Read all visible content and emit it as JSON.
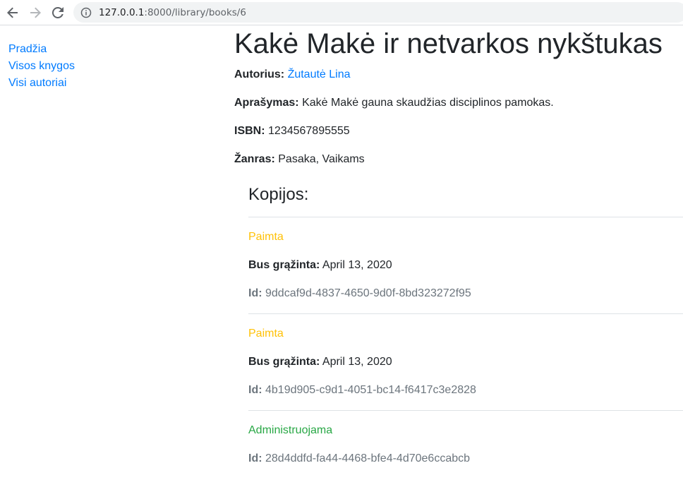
{
  "browser": {
    "url_host": "127.0.0.1",
    "url_path": ":8000/library/books/6"
  },
  "sidebar": {
    "items": [
      {
        "label": "Pradžia"
      },
      {
        "label": "Visos knygos"
      },
      {
        "label": "Visi autoriai"
      }
    ]
  },
  "book": {
    "title": "Kakė Makė ir netvarkos nykštukas",
    "author_label": "Autorius:",
    "author_name": "Žutautė Lina",
    "description_label": "Aprašymas:",
    "description": "Kakė Makė gauna skaudžias disciplinos pamokas.",
    "isbn_label": "ISBN:",
    "isbn": "1234567895555",
    "genre_label": "Žanras:",
    "genre": "Pasaka, Vaikams"
  },
  "copies": {
    "heading": "Kopijos:",
    "due_label": "Bus grąžinta:",
    "id_label": "Id:",
    "items": [
      {
        "status": "Paimta",
        "due": "April 13, 2020",
        "id": "9ddcaf9d-4837-4650-9d0f-8bd323272f95"
      },
      {
        "status": "Paimta",
        "due": "April 13, 2020",
        "id": "4b19d905-c9d1-4051-bc14-f6417c3e2828"
      },
      {
        "status": "Administruojama",
        "id": "28d4ddfd-fa44-4468-bfe4-4d70e6ccabcb"
      }
    ]
  },
  "colors": {
    "link": "#007bff",
    "status_taken": "#ffc107",
    "status_maintenance": "#28a745",
    "muted": "#6c757d"
  }
}
